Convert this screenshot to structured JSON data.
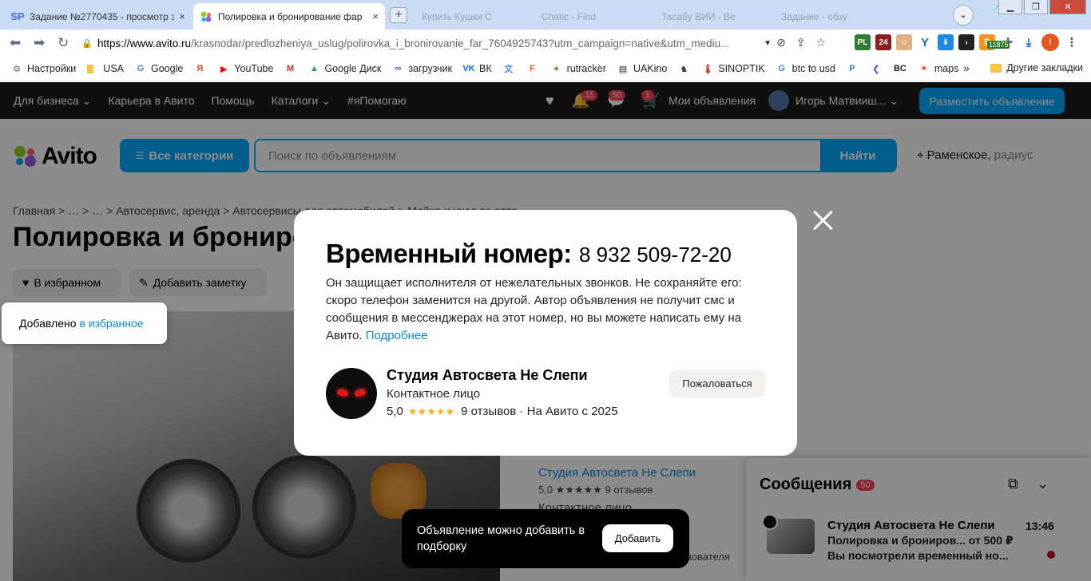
{
  "browser": {
    "tabs": [
      {
        "favicon": "SP",
        "title": "Задание №2770435 - просмотр за",
        "close": "×"
      },
      {
        "favicon": "avito-icon",
        "title": "Полировка и бронирование фар",
        "close": "×"
      }
    ],
    "ghost_tabs": [
      "Купить Кушки С",
      "Chatic - Find",
      "Тасабу ВИИ - Ве",
      "Задание - обзу"
    ],
    "url_host": "https://www.avito.ru",
    "url_path": "/krasnodar/predlozheniya_uslug/polirovka_i_bronirovanie_far_7604925743?utm_campaign=native&utm_mediu...",
    "extension_badge": "11875",
    "profile_initial": "I",
    "bookmarks": [
      {
        "icon": "gear-icon",
        "label": "Настройки",
        "color": "#666666"
      },
      {
        "icon": "folder-icon",
        "label": "USA",
        "color": "#f4c542"
      },
      {
        "icon": "google-icon",
        "label": "Google",
        "color": "#4285f4"
      },
      {
        "icon": "yandex-icon",
        "label": "",
        "color": "#fc3f1d"
      },
      {
        "icon": "youtube-icon",
        "label": "YouTube",
        "color": "#ff0000"
      },
      {
        "icon": "gmail-icon",
        "label": "",
        "color": "#d93025"
      },
      {
        "icon": "gdrive-icon",
        "label": "Google Диск",
        "color": "#1fa463"
      },
      {
        "icon": "loader-icon",
        "label": "загрузчик",
        "color": "#2b5fd9"
      },
      {
        "icon": "vk-icon",
        "label": "ВК",
        "color": "#0077ff"
      },
      {
        "icon": "translate-icon",
        "label": "",
        "color": "#4285f4"
      },
      {
        "icon": "f-icon",
        "label": "",
        "color": "#ff5722"
      },
      {
        "icon": "rutracker-icon",
        "label": "rutracker",
        "color": "#3d7a1f"
      },
      {
        "icon": "uakino-icon",
        "label": "UAKino",
        "color": "#222222"
      },
      {
        "icon": "chess-icon",
        "label": "",
        "color": "#333333"
      },
      {
        "icon": "sinoptik-icon",
        "label": "SINOPTIK",
        "color": "#c0392b"
      },
      {
        "icon": "google-icon",
        "label": "btc to usd",
        "color": "#4285f4"
      },
      {
        "icon": "p-icon",
        "label": "",
        "color": "#1e88e5"
      },
      {
        "icon": "arrow-icon",
        "label": "",
        "color": "#3f51b5"
      },
      {
        "icon": "bc-icon",
        "label": "",
        "color": "#222222"
      },
      {
        "icon": "maps-icon",
        "label": "maps",
        "color": "#ea4335"
      }
    ],
    "bookmarks_more": "»",
    "other_bookmarks": "Другие закладки"
  },
  "avito": {
    "top_links": [
      "Для бизнеса ⌄",
      "Карьера в Авито",
      "Помощь",
      "Каталоги ⌄",
      "#яПомогаю"
    ],
    "badges": {
      "notifications": "11",
      "messages": "50",
      "cart": "1"
    },
    "my_ads": "Мои объявления",
    "user_name": "Игорь Матвииш... ⌄",
    "post_button": "Разместить объявление",
    "logo_text": "Avito",
    "categories_button": "Все категории",
    "search_placeholder": "Поиск по объявлениям",
    "search_button": "Найти",
    "location": "Раменское,",
    "location_suffix": " радиус",
    "breadcrumbs": "Главная  >  …  >  …  >  Автосервис, аренда  >  Автосервисы для автомобилей  >  Мойка и уход за авто",
    "title": "Полировка и бронирование фар",
    "fav_button": "В избранном",
    "note_button": "Добавить заметку",
    "fav_toast_prefix": "Добавлено",
    "fav_toast_link": "в избранное",
    "seller_name": "Студия Автосвета Не Слепи",
    "seller_rating": "5,0 ★★★★★  9 отзывов",
    "seller_role": "Контактное лицо",
    "seller_fragment": "зователя"
  },
  "modal": {
    "heading": "Временный номер:",
    "phone": "8 932 509-72-20",
    "description": "Он защищает исполнителя от нежелательных звонков. Не сохраняйте его: скоро телефон заменится на другой. Автор объявления не получит смс и сообщения в мессенджерах на этот номер, но вы можете написать ему на Авито.",
    "more_link": "Подробнее",
    "seller_name": "Студия Автосвета Не Слепи",
    "seller_role": "Контактное лицо",
    "rating": "5,0",
    "stars": "★★★★★",
    "reviews": "9 отзывов · На Авито с 2025",
    "complain_button": "Пожаловаться"
  },
  "snackbar": {
    "text": "Объявление можно добавить в подборку",
    "button": "Добавить"
  },
  "messages": {
    "title": "Сообщения",
    "count": "50",
    "chat_name": "Студия Автосвета Не Слепи",
    "chat_line1": "Полировка и брониров... от 500 ₽",
    "chat_line2": "Вы посмотрели временный но...",
    "time": "13:46"
  }
}
